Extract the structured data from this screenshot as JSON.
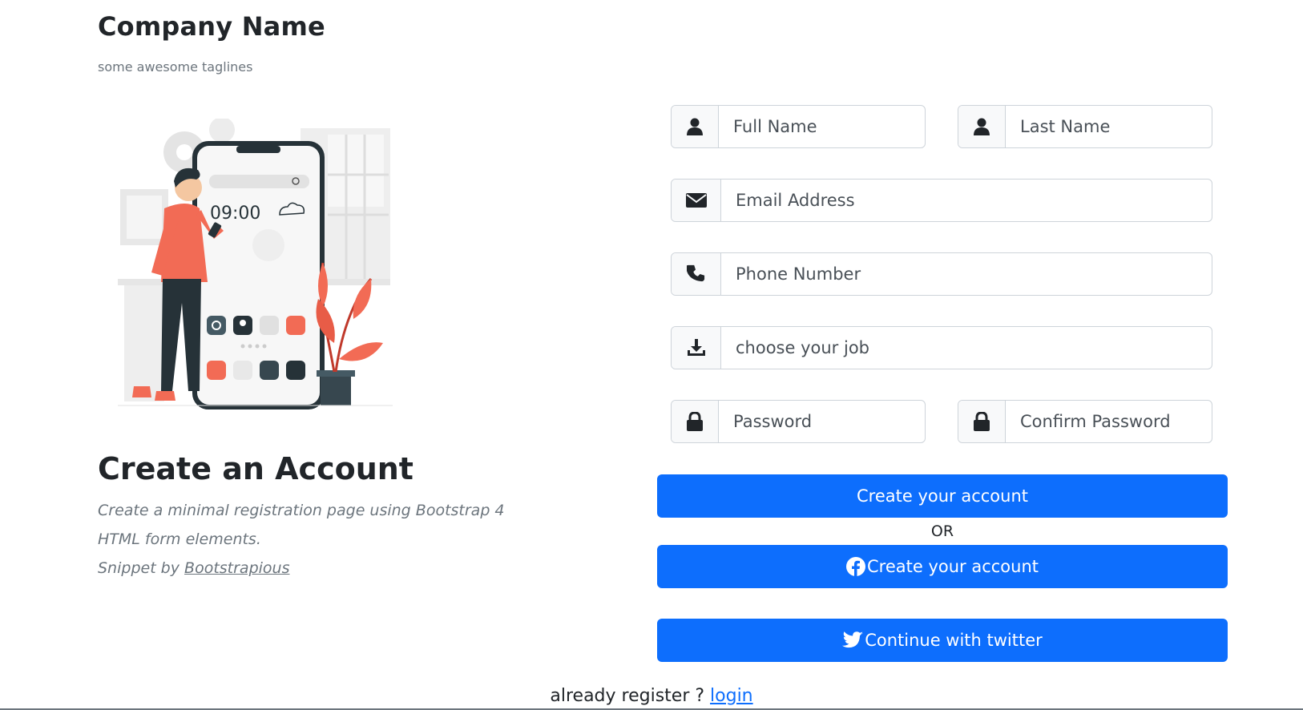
{
  "brand": {
    "name": "Company Name",
    "tagline": "some awesome taglines"
  },
  "illustration": {
    "clock": "09:00"
  },
  "intro": {
    "heading": "Create an Account",
    "line1": "Create a minimal registration page using Bootstrap 4",
    "line2": "HTML form elements.",
    "snippet_prefix": "Snippet by ",
    "snippet_link": "Bootstrapious"
  },
  "form": {
    "first_name": {
      "placeholder": "Full Name",
      "icon": "user-icon"
    },
    "last_name": {
      "placeholder": "Last Name",
      "icon": "user-icon"
    },
    "email": {
      "placeholder": "Email Address",
      "icon": "envelope-icon"
    },
    "phone": {
      "placeholder": "Phone Number",
      "icon": "phone-icon"
    },
    "job": {
      "placeholder": "choose your job",
      "icon": "download-icon"
    },
    "password": {
      "placeholder": "Password",
      "icon": "lock-icon"
    },
    "confirm_password": {
      "placeholder": "Confirm Password",
      "icon": "lock-icon"
    },
    "submit_label": "Create your account",
    "or_label": "OR",
    "facebook_label": "Create your account",
    "twitter_label": "Continue with twitter"
  },
  "footer": {
    "prompt": "already register ? ",
    "login_link": "login"
  },
  "colors": {
    "primary": "#0d6efd",
    "accent_illustration": "#f26b55",
    "dark_illustration": "#263238",
    "muted_text": "#6c757d"
  }
}
